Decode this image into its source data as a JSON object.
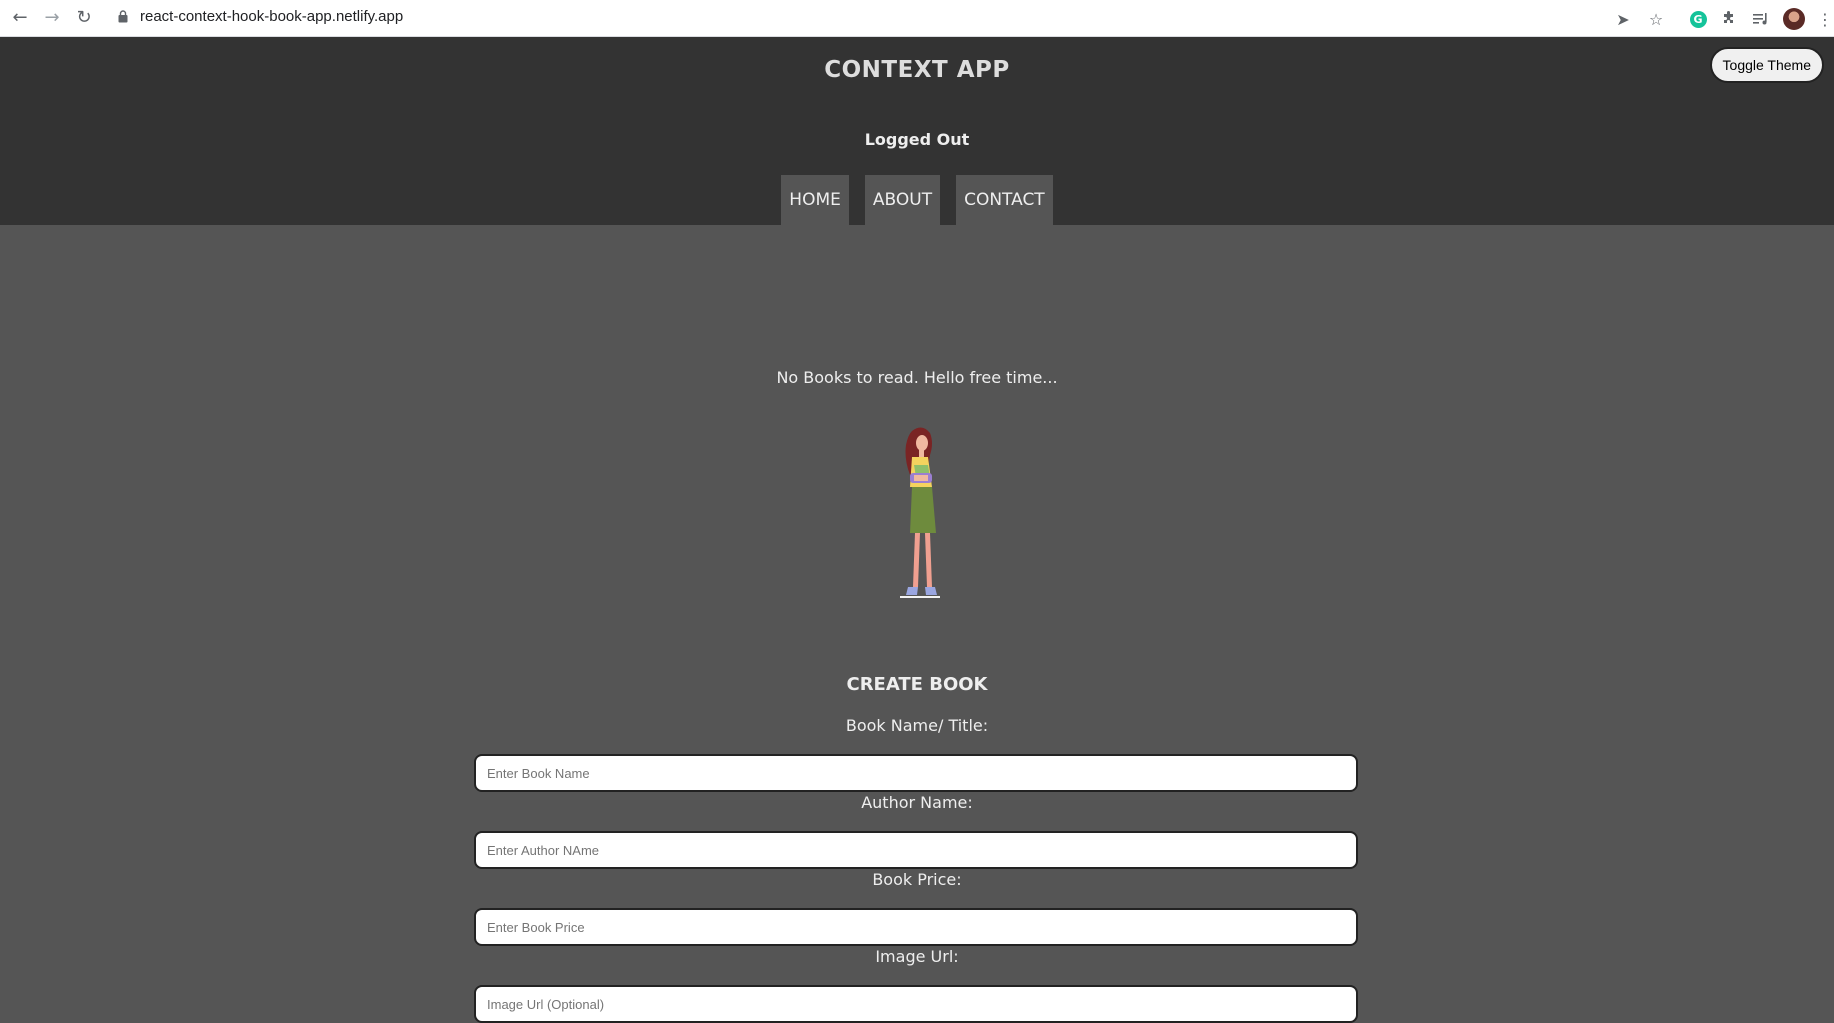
{
  "browser": {
    "url": "react-context-hook-book-app.netlify.app"
  },
  "header": {
    "title": "CONTEXT APP",
    "auth_status": "Logged Out",
    "toggle_theme_label": "Toggle Theme",
    "nav": [
      {
        "label": "HOME"
      },
      {
        "label": "ABOUT"
      },
      {
        "label": "CONTACT"
      }
    ]
  },
  "main": {
    "empty_message": "No Books to read. Hello free time...",
    "form": {
      "title": "CREATE BOOK",
      "fields": [
        {
          "label": "Book Name/ Title:",
          "placeholder": "Enter Book Name",
          "value": ""
        },
        {
          "label": "Author Name:",
          "placeholder": "Enter Author NAme",
          "value": ""
        },
        {
          "label": "Book Price:",
          "placeholder": "Enter Book Price",
          "value": ""
        },
        {
          "label": "Image Url:",
          "placeholder": "Image Url (Optional)",
          "value": ""
        }
      ]
    }
  },
  "colors": {
    "header_bg": "#333333",
    "page_bg": "#555555",
    "nav_item_bg": "#555555",
    "text": "#eeeeee"
  }
}
